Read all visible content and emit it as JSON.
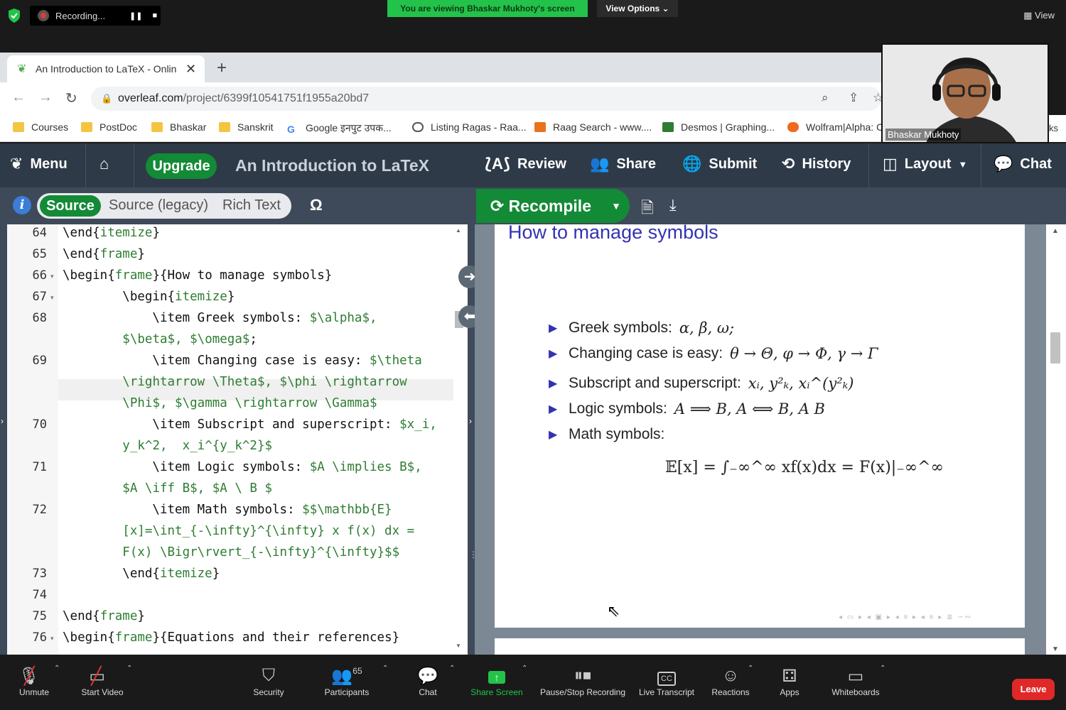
{
  "zoom_top": {
    "recording_label": "Recording...",
    "viewing_banner": "You are viewing Bhaskar Mukhoty's screen",
    "view_options": "View Options ⌄",
    "view_label": "View"
  },
  "browser": {
    "tab_title": "An Introduction to LaTeX - Onlin",
    "url_host": "overleaf.com",
    "url_path": "/project/6399f10541751f1955a20bd7",
    "bookmarks": [
      {
        "label": "Courses"
      },
      {
        "label": "PostDoc"
      },
      {
        "label": "Bhaskar"
      },
      {
        "label": "Sanskrit"
      },
      {
        "label": "Google इनपुट उपक..."
      },
      {
        "label": "Listing Ragas - Raa..."
      },
      {
        "label": "Raag Search - www...."
      },
      {
        "label": "Desmos | Graphing..."
      },
      {
        "label": "Wolfram|Alpha: C"
      }
    ],
    "bookmark_overflow": "ks"
  },
  "webcam": {
    "name": "Bhaskar Mukhoty"
  },
  "overleaf": {
    "menu": "Menu",
    "upgrade": "Upgrade",
    "project_title": "An Introduction to LaTeX",
    "review": "Review",
    "share": "Share",
    "submit": "Submit",
    "history": "History",
    "layout": "Layout",
    "chat": "Chat",
    "source": "Source",
    "source_legacy": "Source (legacy)",
    "rich_text": "Rich Text",
    "omega": "Ω",
    "recompile": "Recompile"
  },
  "editor": {
    "line_numbers": [
      "64",
      "65",
      "66",
      "67",
      "68",
      "",
      "69",
      "",
      "",
      "70",
      "",
      "71",
      "",
      "72",
      "",
      "",
      "73",
      "74",
      "75",
      "76"
    ],
    "lines": [
      {
        "a": "\\end{",
        "g": "itemize",
        "b": "}"
      },
      {
        "a": "\\end{",
        "g": "frame",
        "b": "}"
      },
      {
        "a": "\\begin{",
        "g": "frame",
        "b": "}{How to manage symbols}"
      },
      {
        "a": "        \\begin{",
        "g": "itemize",
        "b": "}"
      },
      {
        "a": "            \\item Greek symbols: ",
        "g": "$\\alpha$,",
        "b": ""
      },
      {
        "a": "        ",
        "g": "$\\beta$, $\\omega$",
        "b": ";"
      },
      {
        "a": "            \\item Changing case is easy: ",
        "g": "$\\theta",
        "b": ""
      },
      {
        "a": "        ",
        "g": "\\rightarrow \\Theta$, $\\phi \\rightarrow",
        "b": ""
      },
      {
        "a": "        ",
        "g": "\\Phi$, $\\gamma \\rightarrow \\Gamma$",
        "b": ""
      },
      {
        "a": "            \\item Subscript and superscript: ",
        "g": "$x_i,",
        "b": ""
      },
      {
        "a": "        ",
        "g": "y_k^2,  x_i^{y_k^2}$",
        "b": ""
      },
      {
        "a": "            \\item Logic symbols: ",
        "g": "$A \\implies B$,",
        "b": ""
      },
      {
        "a": "        ",
        "g": "$A \\iff B$, $A \\ B $",
        "b": ""
      },
      {
        "a": "            \\item Math symbols: ",
        "g": "$$\\mathbb{E}",
        "b": ""
      },
      {
        "a": "        ",
        "g": "[x]=\\int_{-\\infty}^{\\infty} x f(x) dx =",
        "b": ""
      },
      {
        "a": "        ",
        "g": "F(x) \\Bigr\\rvert_{-\\infty}^{\\infty}$$",
        "b": ""
      },
      {
        "a": "        \\end{",
        "g": "itemize",
        "b": "}"
      },
      {
        "a": "",
        "g": "",
        "b": ""
      },
      {
        "a": "\\end{",
        "g": "frame",
        "b": "}"
      },
      {
        "a": "\\begin{",
        "g": "frame",
        "b": "}{Equations and their references}"
      }
    ]
  },
  "pdf": {
    "slide_title": "How to manage symbols",
    "bullets": [
      {
        "text": "Greek symbols:",
        "math": "α, β, ω;"
      },
      {
        "text": "Changing case is easy:",
        "math": "θ → Θ, φ → Φ, γ → Γ"
      },
      {
        "text": "Subscript and superscript:",
        "math": "xᵢ, y²ₖ, xᵢ^(y²ₖ)"
      },
      {
        "text": "Logic symbols:",
        "math": "A ⟹ B, A ⟺ B, A B"
      },
      {
        "text": "Math symbols:",
        "math": ""
      }
    ],
    "equation": "𝔼[x] = ∫₋∞^∞ xf(x)dx = F(x)|₋∞^∞"
  },
  "zoom_bottom": {
    "unmute": "Unmute",
    "start_video": "Start Video",
    "security": "Security",
    "participants": "Participants",
    "participant_count": "65",
    "chat": "Chat",
    "share_screen": "Share Screen",
    "pause_recording": "Pause/Stop Recording",
    "live_transcript": "Live Transcript",
    "reactions": "Reactions",
    "apps": "Apps",
    "whiteboards": "Whiteboards",
    "leave": "Leave"
  },
  "colors": {
    "overleaf_nav": "#2e3a48",
    "overleaf_green": "#138a36",
    "beamer_blue": "#3333b2",
    "zoom_green": "#23c24a",
    "leave_red": "#e02828"
  }
}
